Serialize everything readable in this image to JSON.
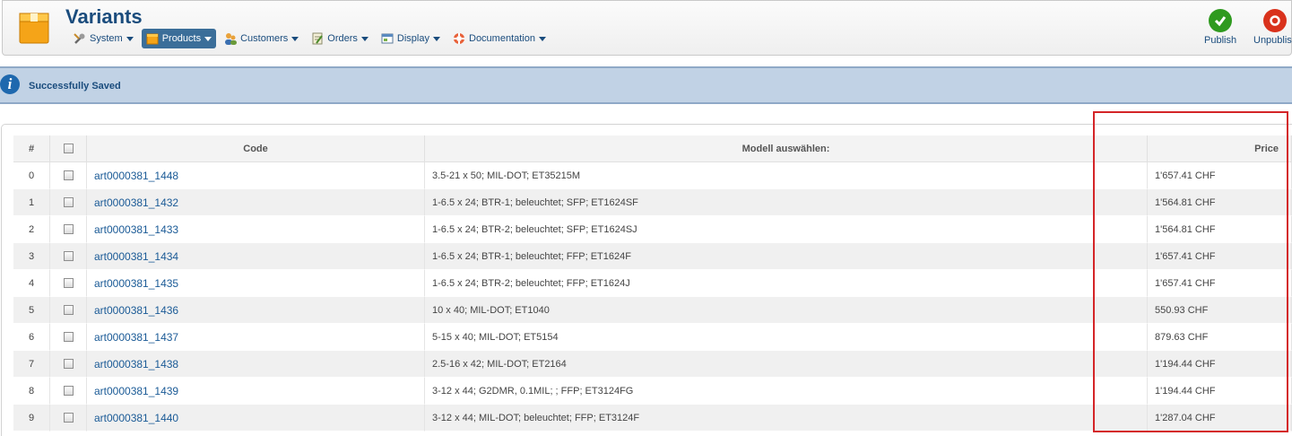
{
  "header": {
    "title": "Variants",
    "menu": [
      {
        "label": "System",
        "icon": "wrench-icon"
      },
      {
        "label": "Products",
        "icon": "box-icon"
      },
      {
        "label": "Customers",
        "icon": "users-icon"
      },
      {
        "label": "Orders",
        "icon": "orders-icon"
      },
      {
        "label": "Display",
        "icon": "display-icon"
      },
      {
        "label": "Documentation",
        "icon": "lifebuoy-icon"
      }
    ],
    "toolbar": {
      "publish_label": "Publish",
      "unpublish_label": "Unpublish"
    }
  },
  "message": {
    "text": "Successfully Saved"
  },
  "table": {
    "columns": [
      "#",
      "",
      "Code",
      "Modell auswählen:",
      "Price"
    ],
    "rows": [
      {
        "num": "0",
        "code": "art0000381_1448",
        "model": "3.5-21 x 50; MIL-DOT; ET35215M",
        "price": "1'657.41 CHF"
      },
      {
        "num": "1",
        "code": "art0000381_1432",
        "model": "1-6.5 x 24; BTR-1; beleuchtet; SFP; ET1624SF",
        "price": "1'564.81 CHF"
      },
      {
        "num": "2",
        "code": "art0000381_1433",
        "model": "1-6.5 x 24; BTR-2; beleuchtet; SFP; ET1624SJ",
        "price": "1'564.81 CHF"
      },
      {
        "num": "3",
        "code": "art0000381_1434",
        "model": "1-6.5 x 24; BTR-1; beleuchtet; FFP; ET1624F",
        "price": "1'657.41 CHF"
      },
      {
        "num": "4",
        "code": "art0000381_1435",
        "model": "1-6.5 x 24; BTR-2; beleuchtet; FFP; ET1624J",
        "price": "1'657.41 CHF"
      },
      {
        "num": "5",
        "code": "art0000381_1436",
        "model": "10 x 40; MIL-DOT; ET1040",
        "price": "550.93 CHF"
      },
      {
        "num": "6",
        "code": "art0000381_1437",
        "model": "5-15 x 40; MIL-DOT; ET5154",
        "price": "879.63 CHF"
      },
      {
        "num": "7",
        "code": "art0000381_1438",
        "model": "2.5-16 x 42; MIL-DOT; ET2164",
        "price": "1'194.44 CHF"
      },
      {
        "num": "8",
        "code": "art0000381_1439",
        "model": "3-12 x 44; G2DMR, 0.1MIL; ; FFP; ET3124FG",
        "price": "1'194.44 CHF"
      },
      {
        "num": "9",
        "code": "art0000381_1440",
        "model": "3-12 x 44; MIL-DOT; beleuchtet; FFP; ET3124F",
        "price": "1'287.04 CHF"
      }
    ]
  },
  "colors": {
    "brand_blue": "#1a4c7d",
    "link_blue": "#1a5a96",
    "highlight_red": "#d42528",
    "publish_green": "#2f9a1f",
    "unpublish_red": "#d9321c"
  }
}
